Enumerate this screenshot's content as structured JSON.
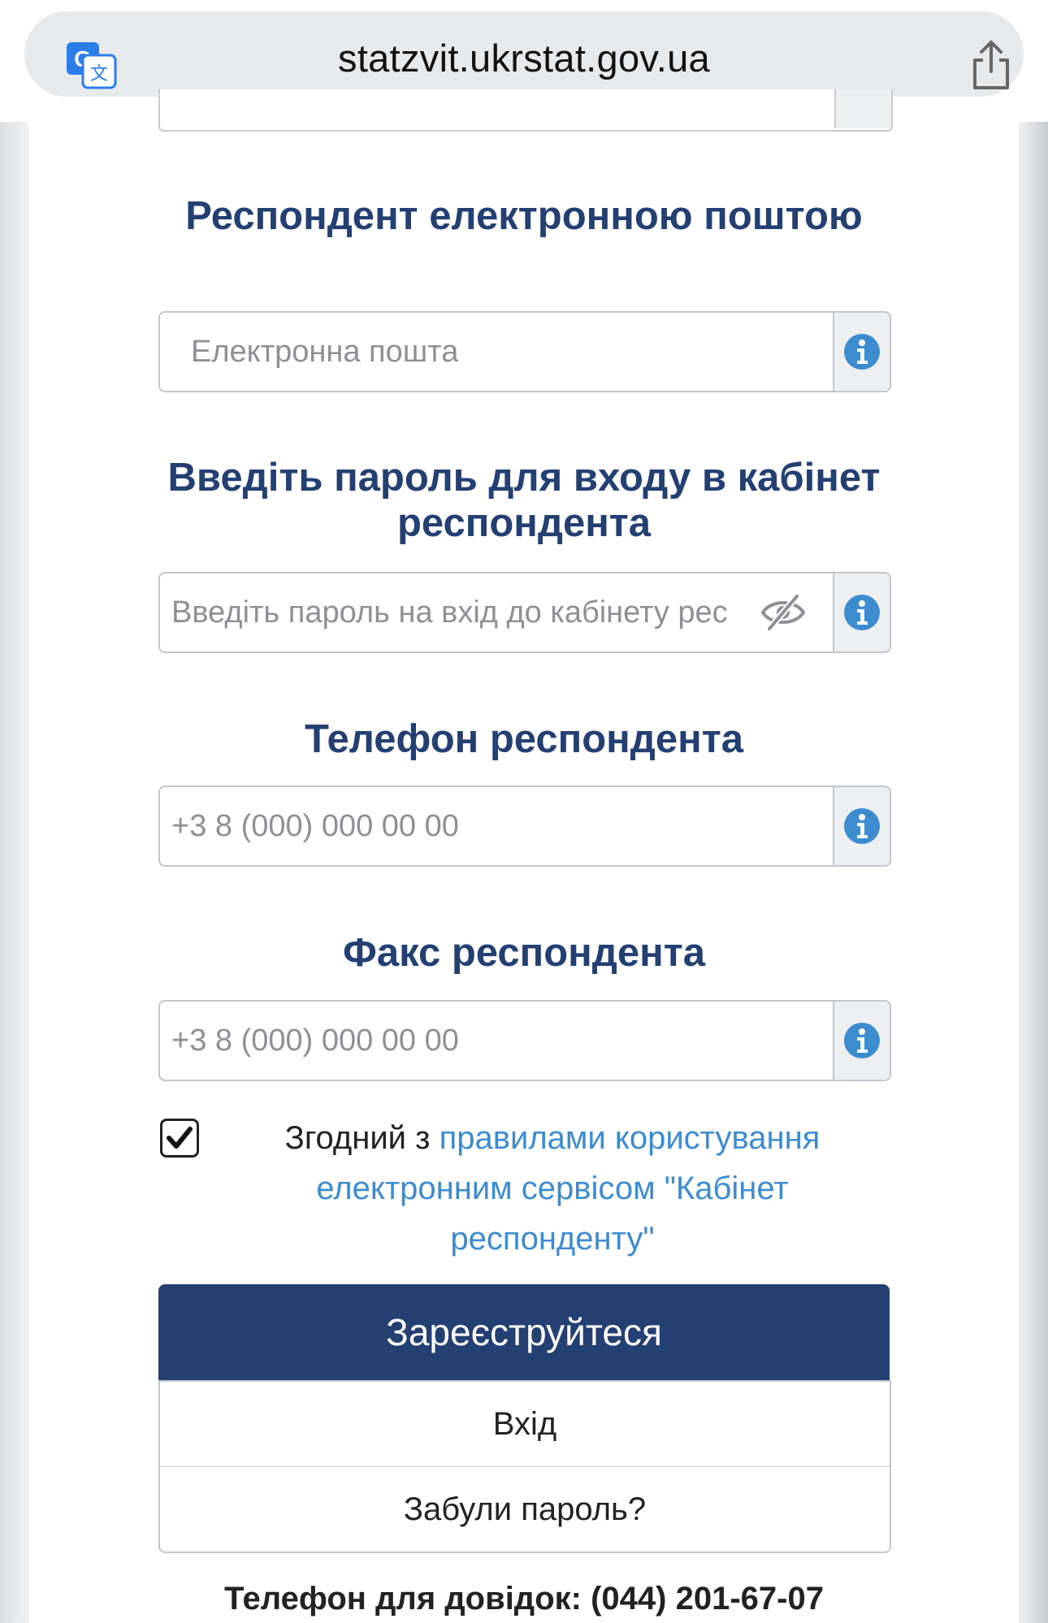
{
  "browser": {
    "url": "statzvit.ukrstat.gov.ua",
    "translate_icon": "translate-icon",
    "share_icon": "share-icon"
  },
  "form": {
    "email_section": {
      "title": "Респондент електронною поштою",
      "placeholder": "Електронна пошта"
    },
    "password_section": {
      "title": "Введіть пароль для входу в кабінет респондента",
      "placeholder": "Введіть пароль на вхід до кабінету рес"
    },
    "phone_section": {
      "title": "Телефон респондента",
      "placeholder": "+3 8 (000) 000 00 00"
    },
    "fax_section": {
      "title": "Факс респондента",
      "placeholder": "+3 8 (000) 000 00 00"
    },
    "agreement": {
      "checked": true,
      "prefix": "Згодний з",
      "link_text": "правилами користування електронним сервісом \"Кабінет респонденту\""
    },
    "register_button": "Зареєструйтеся",
    "login_button": "Вхід",
    "forgot_password_button": "Забули пароль?",
    "support_phone": "Телефон для довідок: (044) 201-67-07"
  },
  "colors": {
    "title": "#243f72",
    "primary_button": "#243f72",
    "link": "#3d8cd0",
    "info_icon": "#3d8cd0"
  }
}
